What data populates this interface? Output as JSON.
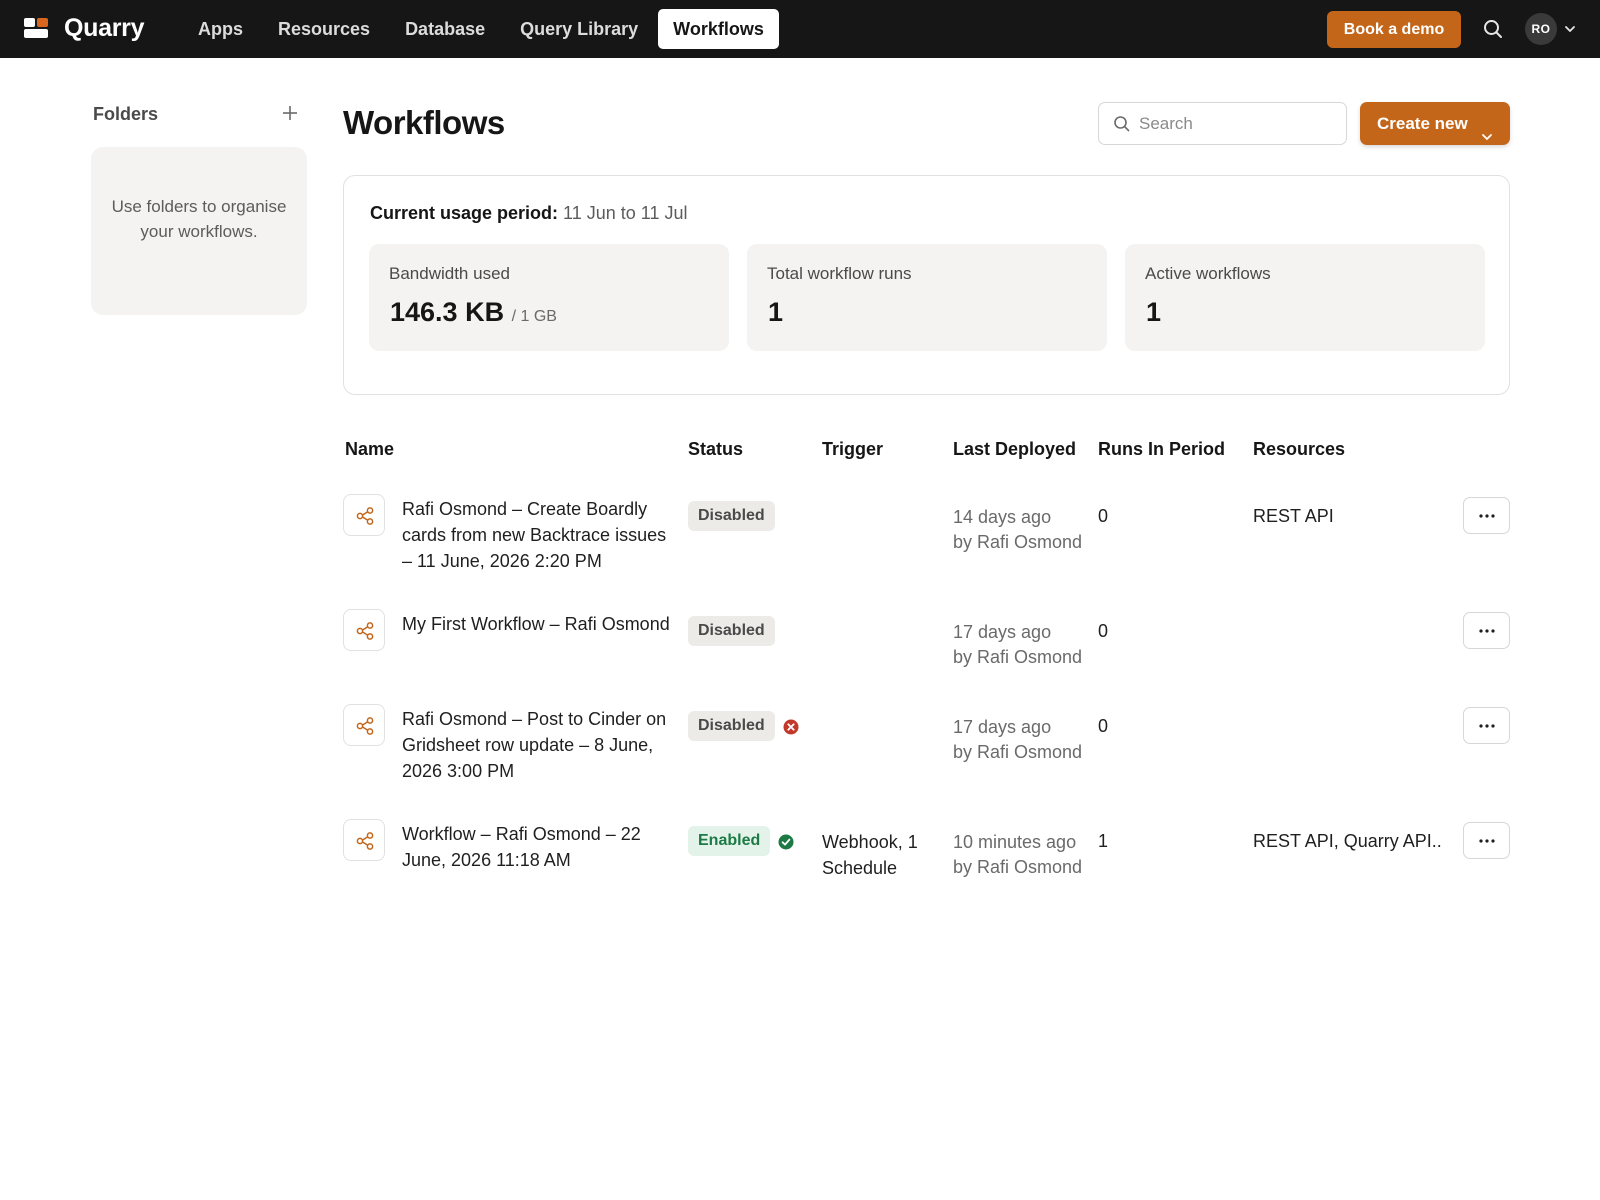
{
  "app": {
    "name": "Quarry"
  },
  "nav": {
    "items": [
      {
        "label": "Apps"
      },
      {
        "label": "Resources"
      },
      {
        "label": "Database"
      },
      {
        "label": "Query Library"
      },
      {
        "label": "Workflows",
        "active": true
      }
    ],
    "book_demo": "Book a demo",
    "avatar_initials": "RO"
  },
  "sidebar": {
    "title": "Folders",
    "empty_hint": "Use folders to organise your workflows."
  },
  "main": {
    "title": "Workflows",
    "search_placeholder": "Search",
    "create_label": "Create new"
  },
  "usage": {
    "period_label": "Current usage period:",
    "period_value": "11 Jun to 11 Jul",
    "stats": [
      {
        "label": "Bandwidth used",
        "value": "146.3 KB",
        "sub": "/ 1 GB"
      },
      {
        "label": "Total workflow runs",
        "value": "1",
        "sub": ""
      },
      {
        "label": "Active workflows",
        "value": "1",
        "sub": ""
      }
    ]
  },
  "table": {
    "headers": {
      "name": "Name",
      "status": "Status",
      "trigger": "Trigger",
      "last_deployed": "Last Deployed",
      "runs": "Runs In Period",
      "resources": "Resources"
    },
    "rows": [
      {
        "name": "Rafi Osmond – Create Boardly cards from new Backtrace issues – 11 June, 2026 2:20 PM",
        "status": "Disabled",
        "status_icon": "none",
        "trigger": "",
        "deployed_when": "14 days ago",
        "deployed_by": "by Rafi Osmond",
        "runs": "0",
        "resources": "REST API"
      },
      {
        "name": "My First Workflow – Rafi Osmond",
        "status": "Disabled",
        "status_icon": "none",
        "trigger": "",
        "deployed_when": "17 days ago",
        "deployed_by": "by Rafi Osmond",
        "runs": "0",
        "resources": ""
      },
      {
        "name": "Rafi Osmond – Post to Cinder on Gridsheet row update – 8 June, 2026 3:00 PM",
        "status": "Disabled",
        "status_icon": "error-icon",
        "trigger": "",
        "deployed_when": "17 days ago",
        "deployed_by": "by Rafi Osmond",
        "runs": "0",
        "resources": ""
      },
      {
        "name": "Workflow – Rafi Osmond – 22 June, 2026 11:18 AM",
        "status": "Enabled",
        "status_icon": "check-circle-icon",
        "trigger": "Webhook, 1 Schedule",
        "deployed_when": "10 minutes ago",
        "deployed_by": "by Rafi Osmond",
        "runs": "1",
        "resources": "REST API, Quarry API..."
      }
    ]
  },
  "colors": {
    "topbar": "#161616",
    "accent": "#c4661a",
    "enabled": "#1d7a45",
    "error": "#c0392b"
  }
}
